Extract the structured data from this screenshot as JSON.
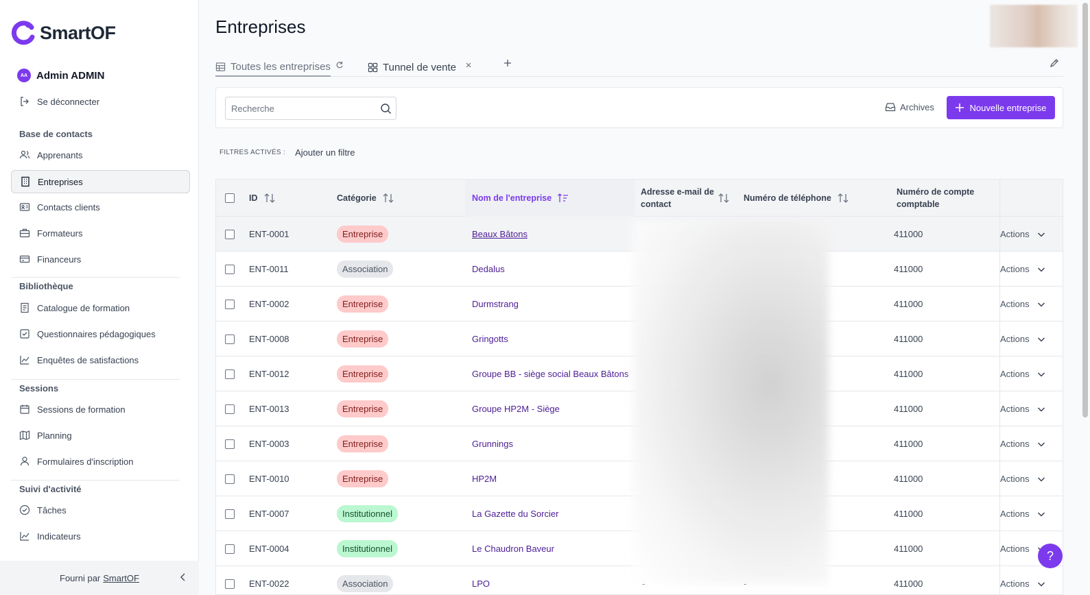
{
  "brand": {
    "name": "SmartOF",
    "accent": "#7c3aed"
  },
  "user": {
    "initials": "AA",
    "name": "Admin ADMIN",
    "logout": "Se déconnecter"
  },
  "sidebar": {
    "sections": [
      {
        "title": "Base de contacts",
        "items": [
          "Apprenants",
          "Entreprises",
          "Contacts clients",
          "Formateurs",
          "Financeurs"
        ]
      },
      {
        "title": "Bibliothèque",
        "items": [
          "Catalogue de formation",
          "Questionnaires pédagogiques",
          "Enquêtes de satisfactions"
        ]
      },
      {
        "title": "Sessions",
        "items": [
          "Sessions de formation",
          "Planning",
          "Formulaires d'inscription"
        ]
      },
      {
        "title": "Suivi d'activité",
        "items": [
          "Tâches",
          "Indicateurs"
        ]
      }
    ],
    "active": "Entreprises",
    "footer_prefix": "Fourni par",
    "footer_link": "SmartOF"
  },
  "page": {
    "title": "Entreprises"
  },
  "tabs": [
    {
      "label": "Toutes les entreprises",
      "active": true
    },
    {
      "label": "Tunnel de vente",
      "active": false
    }
  ],
  "toolbar": {
    "search_placeholder": "Recherche",
    "archives": "Archives",
    "new_button": "Nouvelle entreprise"
  },
  "filters": {
    "label": "FILTRES ACTIVÉS :",
    "add": "Ajouter un filtre"
  },
  "table": {
    "columns": {
      "id": "ID",
      "category": "Catégorie",
      "name": "Nom de l'entreprise",
      "email": "Adresse e-mail de contact",
      "phone": "Numéro de téléphone",
      "account": "Numéro de compte comptable"
    },
    "rows": [
      {
        "id": "ENT-0001",
        "category": "Entreprise",
        "name": "Beaux Bâtons",
        "email": "",
        "phone": "",
        "account": "411000",
        "actions": "Actions"
      },
      {
        "id": "ENT-0011",
        "category": "Association",
        "name": "Dedalus",
        "email": "",
        "phone": "",
        "account": "411000",
        "actions": "Actions"
      },
      {
        "id": "ENT-0002",
        "category": "Entreprise",
        "name": "Durmstrang",
        "email": "",
        "phone": "",
        "account": "411000",
        "actions": "Actions"
      },
      {
        "id": "ENT-0008",
        "category": "Entreprise",
        "name": "Gringotts",
        "email": "",
        "phone": "",
        "account": "411000",
        "actions": "Actions"
      },
      {
        "id": "ENT-0012",
        "category": "Entreprise",
        "name": "Groupe BB - siège social Beaux Bâtons",
        "email": "",
        "phone": "",
        "account": "411000",
        "actions": "Actions"
      },
      {
        "id": "ENT-0013",
        "category": "Entreprise",
        "name": "Groupe HP2M - Siège",
        "email": "",
        "phone": "",
        "account": "411000",
        "actions": "Actions"
      },
      {
        "id": "ENT-0003",
        "category": "Entreprise",
        "name": "Grunnings",
        "email": "",
        "phone": "",
        "account": "411000",
        "actions": "Actions"
      },
      {
        "id": "ENT-0010",
        "category": "Entreprise",
        "name": "HP2M",
        "email": "",
        "phone": "",
        "account": "411000",
        "actions": "Actions"
      },
      {
        "id": "ENT-0007",
        "category": "Institutionnel",
        "name": "La Gazette du Sorcier",
        "email": "",
        "phone": "",
        "account": "411000",
        "actions": "Actions"
      },
      {
        "id": "ENT-0004",
        "category": "Institutionnel",
        "name": "Le Chaudron Baveur",
        "email": "",
        "phone": "",
        "account": "411000",
        "actions": "Actions"
      },
      {
        "id": "ENT-0022",
        "category": "Association",
        "name": "LPO",
        "email": "-",
        "phone": "-",
        "account": "411000",
        "actions": "Actions"
      }
    ]
  },
  "help": "?"
}
